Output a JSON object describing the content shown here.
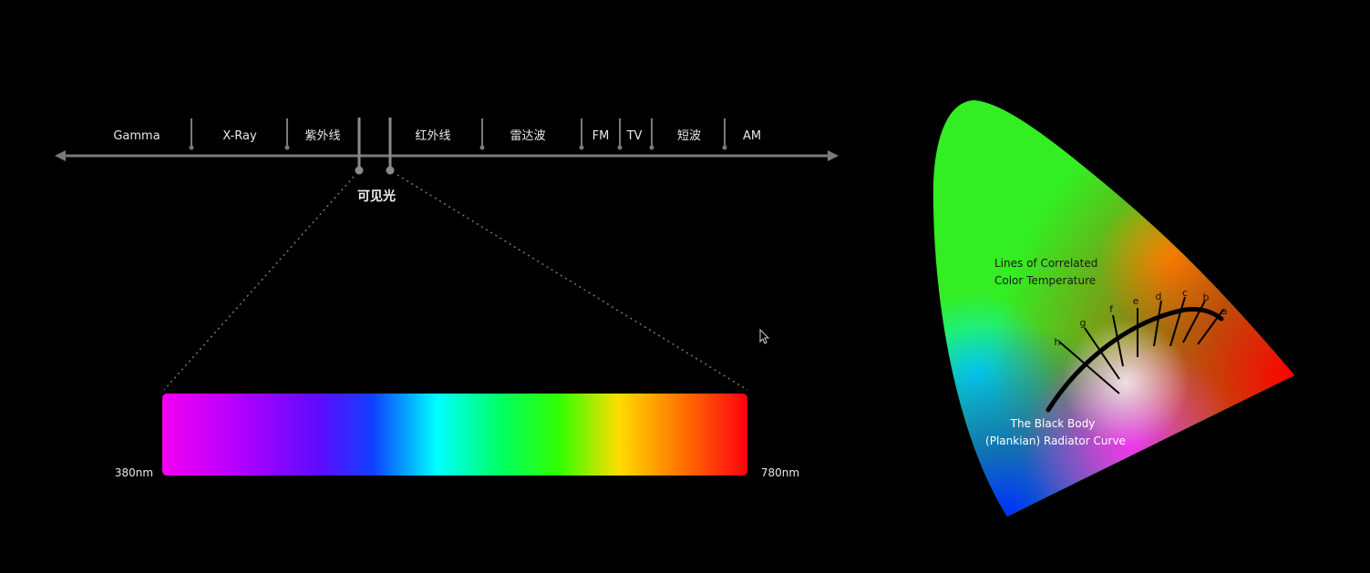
{
  "spectrum": {
    "bands": [
      {
        "id": "gamma",
        "label": "Gamma"
      },
      {
        "id": "xray",
        "label": "X-Ray"
      },
      {
        "id": "uv",
        "label": "紫外线"
      },
      {
        "id": "ir",
        "label": "红外线"
      },
      {
        "id": "radar",
        "label": "雷达波"
      },
      {
        "id": "fm",
        "label": "FM"
      },
      {
        "id": "tv",
        "label": "TV"
      },
      {
        "id": "shortwave",
        "label": "短波"
      },
      {
        "id": "am",
        "label": "AM"
      }
    ],
    "visible_label": "可见光",
    "range_start": "380nm",
    "range_end": "780nm",
    "line_color": "#7a7a7a"
  },
  "cie": {
    "lines_label_1": "Lines of Correlated",
    "lines_label_2": "Color Temperature",
    "curve_label_1": "The Black Body",
    "curve_label_2": "(Plankian)  Radiator Curve",
    "tick_letters": [
      "a",
      "b",
      "c",
      "d",
      "e",
      "f",
      "g",
      "h"
    ]
  }
}
